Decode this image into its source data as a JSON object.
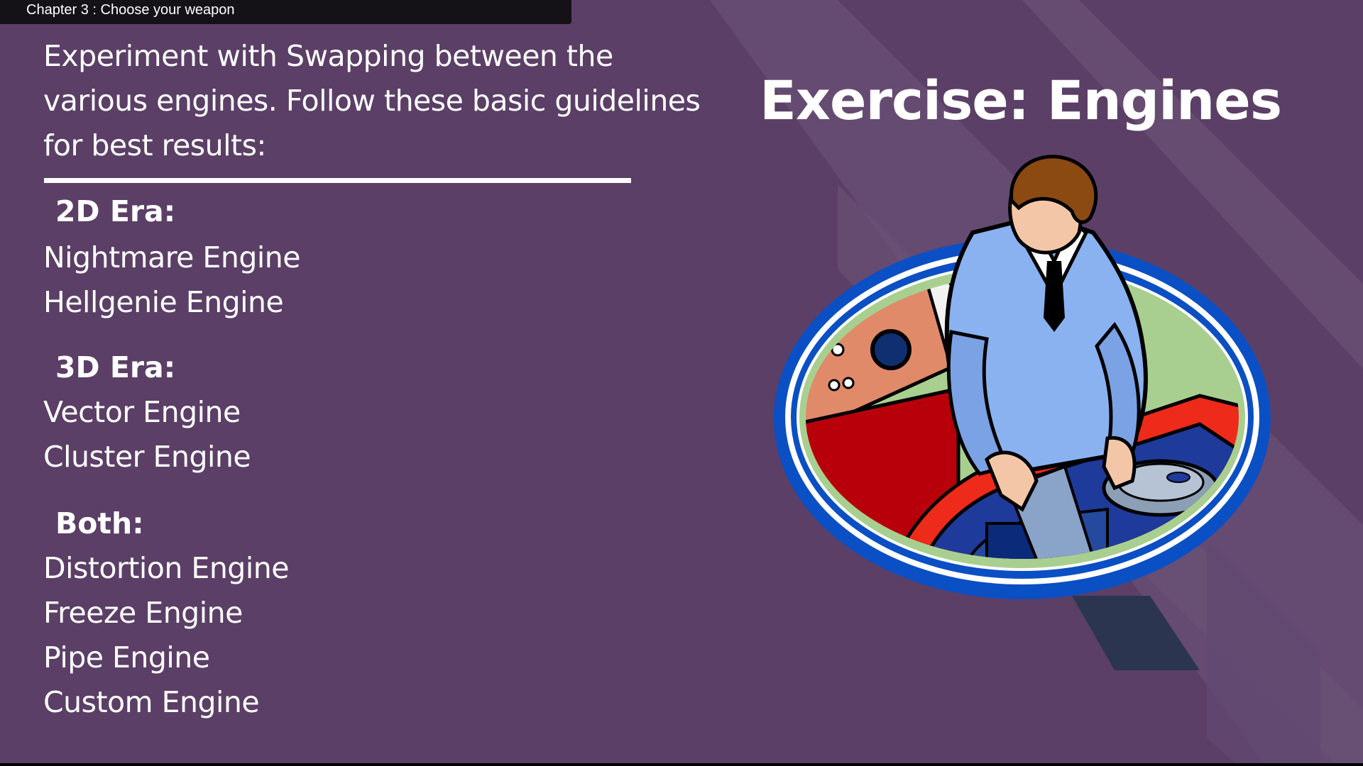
{
  "header": {
    "chapter_label": "Chapter 3 : Choose your weapon"
  },
  "slide": {
    "title": "Exercise: Engines",
    "intro_text": " Experiment with Swapping between the various engines.  Follow these basic guidelines for best results:",
    "groups": [
      {
        "heading": "2D Era:",
        "engines": [
          "Nightmare Engine",
          "Hellgenie Engine"
        ]
      },
      {
        "heading": "3D Era:",
        "engines": [
          "Vector Engine",
          "Cluster Engine"
        ]
      },
      {
        "heading": "Both:",
        "engines": [
          "Distortion Engine",
          "Freeze Engine",
          "Pipe Engine",
          "Custom Engine"
        ]
      }
    ]
  },
  "illustration": {
    "icon": "mechanic-engine-illustration",
    "subject": "mechanic-icon"
  },
  "colors": {
    "background": "#5b3f66",
    "header_bar": "#141216",
    "text": "#ffffff",
    "oval_ring": "#0b4fc4",
    "oval_fill": "#a9cf90",
    "car_red": "#b8000b",
    "coat_blue": "#8ab2f0"
  }
}
